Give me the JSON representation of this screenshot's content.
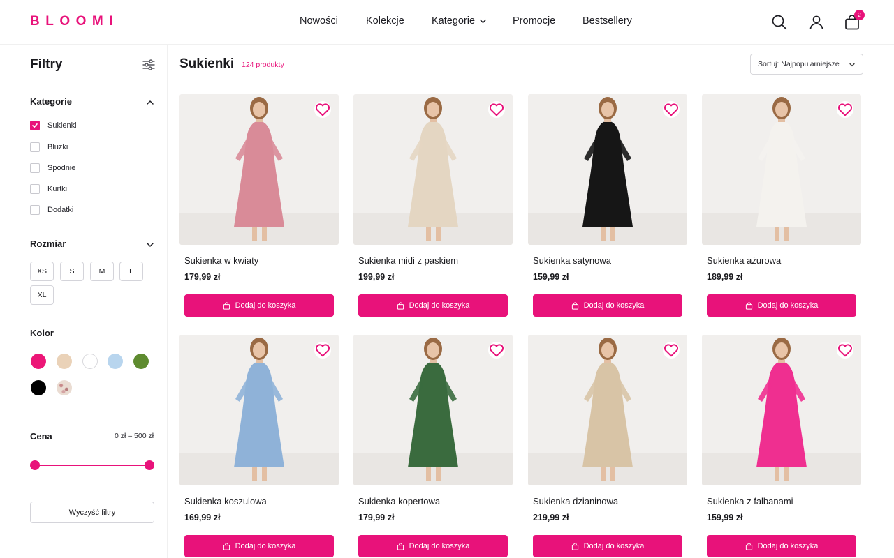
{
  "brand": {
    "logo": "BLOOMI",
    "accent": "#e8127a"
  },
  "nav": [
    {
      "label": "Nowości"
    },
    {
      "label": "Kolekcje"
    },
    {
      "label": "Kategorie",
      "dropdown": true
    },
    {
      "label": "Promocje"
    },
    {
      "label": "Bestsellery"
    }
  ],
  "header_icons": {
    "search": "search-icon",
    "account": "user-icon",
    "cart": "shopping-bag-icon",
    "cart_count": "2"
  },
  "sidebar": {
    "title": "Filtry",
    "category": {
      "title": "Kategorie",
      "items": [
        {
          "label": "Sukienki",
          "checked": true
        },
        {
          "label": "Bluzki",
          "checked": false
        },
        {
          "label": "Spodnie",
          "checked": false
        },
        {
          "label": "Kurtki",
          "checked": false
        },
        {
          "label": "Dodatki",
          "checked": false
        }
      ]
    },
    "size": {
      "title": "Rozmiar",
      "options": [
        "XS",
        "S",
        "M",
        "L",
        "XL"
      ]
    },
    "color": {
      "title": "Kolor",
      "swatches": [
        "#ec1677",
        "#ead2b8",
        "#ffffff",
        "#b8d5ee",
        "#5e8b2f",
        "#000000",
        "floral"
      ]
    },
    "price": {
      "title": "Cena",
      "range": "0 zł – 500 zł",
      "min": 0,
      "max": 500
    },
    "clear_label": "Wyczyść filtry"
  },
  "main": {
    "title": "Sukienki",
    "count": "124 produkty",
    "sort_label": "Sortuj: Najpopularniejsze",
    "add_label": "Dodaj do koszyka",
    "products": [
      {
        "name": "Sukienka w kwiaty",
        "price": "179,99 zł",
        "color": "#d98b98"
      },
      {
        "name": "Sukienka midi z paskiem",
        "price": "199,99 zł",
        "color": "#e4d6c2"
      },
      {
        "name": "Sukienka satynowa",
        "price": "159,99 zł",
        "color": "#161616"
      },
      {
        "name": "Sukienka ażurowa",
        "price": "189,99 zł",
        "color": "#f4f2ee"
      },
      {
        "name": "Sukienka koszulowa",
        "price": "169,99 zł",
        "color": "#8fb2d8"
      },
      {
        "name": "Sukienka kopertowa",
        "price": "179,99 zł",
        "color": "#3a6b3e"
      },
      {
        "name": "Sukienka dzianinowa",
        "price": "219,99 zł",
        "color": "#d8c4a6"
      },
      {
        "name": "Sukienka z falbanami",
        "price": "159,99 zł",
        "color": "#ef2f90"
      }
    ]
  }
}
